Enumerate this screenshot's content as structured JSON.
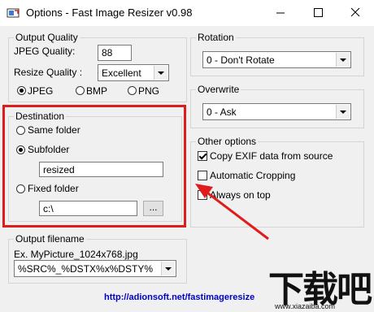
{
  "window": {
    "title": "Options - Fast Image Resizer v0.98",
    "minimize_glyph": "—",
    "maximize_glyph": "☐",
    "close_glyph": "✕"
  },
  "output_quality": {
    "group_label": "Output Quality",
    "jpeg_quality_label": "JPEG Quality:",
    "jpeg_quality_value": "88",
    "resize_quality_label": "Resize Quality :",
    "resize_quality_value": "Excellent",
    "formats": [
      {
        "label": "JPEG",
        "selected": true
      },
      {
        "label": "BMP",
        "selected": false
      },
      {
        "label": "PNG",
        "selected": false
      }
    ]
  },
  "destination": {
    "group_label": "Destination",
    "same_folder_label": "Same folder",
    "subfolder_label": "Subfolder",
    "subfolder_value": "resized",
    "fixed_folder_label": "Fixed folder",
    "fixed_folder_value": "c:\\",
    "browse_label": "...",
    "selected": "Subfolder"
  },
  "output_filename": {
    "group_label": "Output filename",
    "example": "Ex. MyPicture_1024x768.jpg",
    "pattern_value": "%SRC%_%DSTX%x%DSTY%"
  },
  "rotation": {
    "group_label": "Rotation",
    "value": "0 - Don't Rotate"
  },
  "overwrite": {
    "group_label": "Overwrite",
    "value": "0 - Ask"
  },
  "other_options": {
    "group_label": "Other options",
    "copy_exif_label": "Copy EXIF data from source",
    "copy_exif_checked": true,
    "auto_crop_label": "Automatic Cropping",
    "auto_crop_checked": false,
    "always_on_top_label": "Always on top",
    "always_on_top_checked": false
  },
  "footer": {
    "link_text": "http://adionsoft.net/fastimageresize"
  },
  "watermark": {
    "text": "下载吧",
    "url": "www.xiazaiba.com"
  },
  "colors": {
    "annotation_red": "#e01b1b",
    "link_blue": "#0000cc"
  }
}
